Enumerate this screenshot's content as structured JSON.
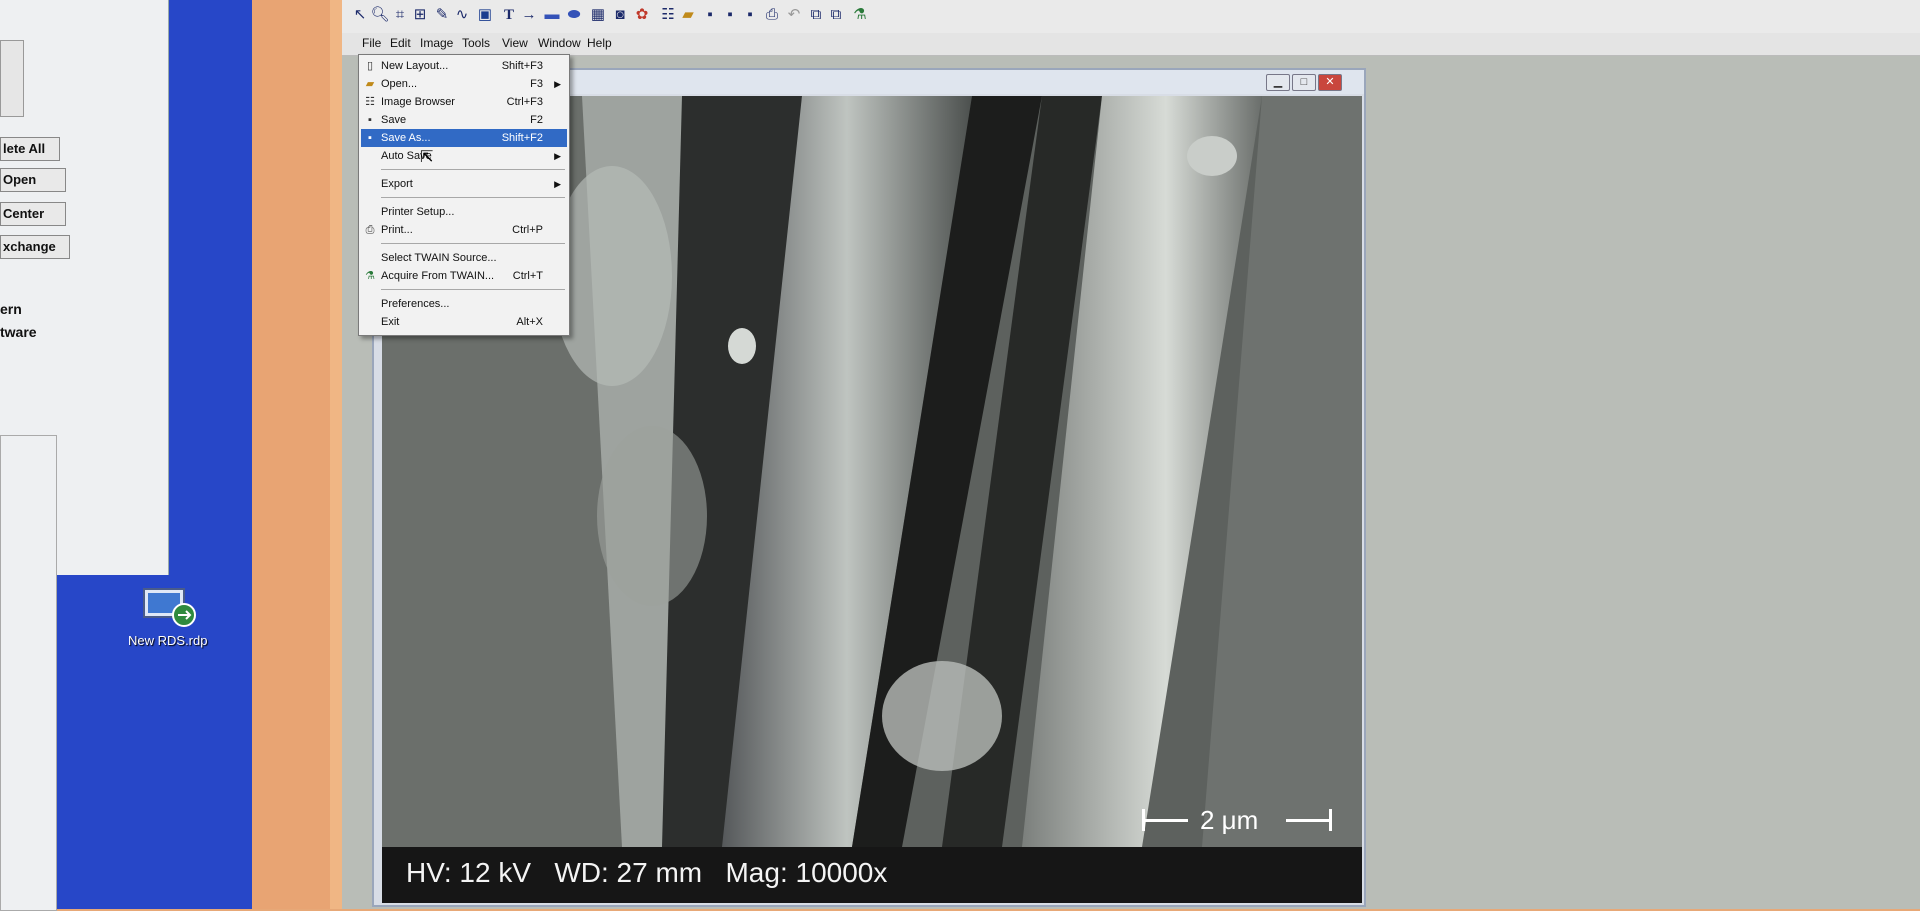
{
  "left_panel": {
    "buttons": [
      "lete All",
      "Open",
      "Center",
      "xchange"
    ],
    "texts": [
      "ern",
      "tware"
    ]
  },
  "desktop": {
    "rdp_icon_label": "New RDS.rdp"
  },
  "menubar": {
    "items": [
      "File",
      "Edit",
      "Image",
      "Tools",
      "View",
      "Window",
      "Help"
    ]
  },
  "file_menu": {
    "items": [
      {
        "label": "New Layout...",
        "shortcut": "Shift+F3",
        "icon": "page-icon"
      },
      {
        "label": "Open...",
        "shortcut": "F3",
        "icon": "folder-open-icon",
        "submenu": true
      },
      {
        "label": "Image Browser",
        "shortcut": "Ctrl+F3",
        "icon": "image-browser-icon"
      },
      {
        "label": "Save",
        "shortcut": "F2",
        "icon": "floppy-disk-icon"
      },
      {
        "label": "Save As...",
        "shortcut": "Shift+F2",
        "icon": "save-as-icon",
        "selected": true
      },
      {
        "label": "Auto Save",
        "shortcut": "",
        "submenu": true
      },
      {
        "label": "Export",
        "shortcut": "",
        "submenu": true
      },
      {
        "label": "Printer Setup...",
        "shortcut": ""
      },
      {
        "label": "Print...",
        "shortcut": "Ctrl+P",
        "icon": "printer-icon"
      },
      {
        "label": "Select TWAIN Source...",
        "shortcut": ""
      },
      {
        "label": "Acquire From TWAIN...",
        "shortcut": "Ctrl+T",
        "icon": "scanner-icon"
      },
      {
        "label": "Preferences...",
        "shortcut": ""
      },
      {
        "label": "Exit",
        "shortcut": "Alt+X"
      }
    ]
  },
  "image_window": {
    "info_text": "HV: 12 kV   WD: 27 mm   Mag: 10000x",
    "scale_label": "2 μm"
  },
  "toolbar_icons": [
    "select-arrow-icon",
    "zoom-icon",
    "crop-icon",
    "resize-icon",
    "text-annot-icon",
    "line-profile-icon",
    "text-tool-icon",
    "arrow-tool-icon",
    "rectangle-tool-icon",
    "ellipse-tool-icon",
    "grid-icon",
    "camera-icon",
    "palette-icon",
    "layout-icon",
    "open-folder-icon",
    "save-icon",
    "save-all-icon",
    "save-layout-icon",
    "print-icon",
    "undo-icon",
    "copy-icon",
    "paste-icon",
    "twain-icon"
  ],
  "colors": {
    "menu_selected": "#316ac5",
    "desktop_blue": "#2747c8",
    "bezel": "#e8a473"
  }
}
